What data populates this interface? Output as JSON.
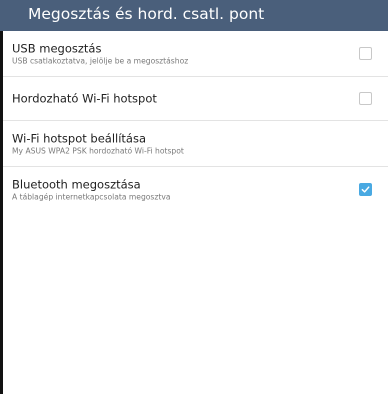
{
  "header": {
    "title": "Megosztás és hord. csatl. pont"
  },
  "preferences": [
    {
      "title": "USB megosztás",
      "summary": "USB csatlakoztatva, jelölje be a megosztáshoz",
      "checked": false
    },
    {
      "title": "Hordozható Wi-Fi hotspot",
      "checked": false
    },
    {
      "title": "Wi-Fi hotspot beállítása",
      "summary": "My ASUS WPA2 PSK hordozható Wi-Fi hotspot"
    },
    {
      "title": "Bluetooth megosztása",
      "summary": "A táblagép internetkapcsolata megosztva",
      "checked": true
    }
  ],
  "colors": {
    "action_bar": "#4a5f7b",
    "checkbox_checked": "#49a9e2",
    "divider": "#e3e3e3"
  },
  "icons": {
    "checked": "checkmark-icon"
  }
}
